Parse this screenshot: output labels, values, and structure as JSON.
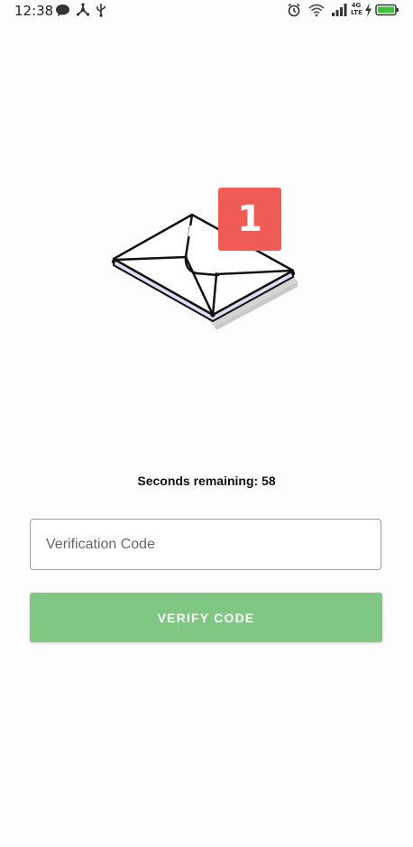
{
  "status_bar": {
    "time": "12:38",
    "left_icons": [
      "chat-bubble-icon",
      "network-share-icon",
      "usb-icon"
    ],
    "right_icons": [
      "alarm-icon",
      "wifi-icon",
      "signal-icon",
      "lte-icon",
      "charging-bolt-icon",
      "battery-icon"
    ],
    "network_label_top": "4G",
    "network_label_bottom": "LTE"
  },
  "illustration": {
    "badge_count": "1",
    "badge_color": "#f15b55"
  },
  "countdown": {
    "text": "Seconds remaining: 58"
  },
  "verification": {
    "placeholder": "Verification Code",
    "value": ""
  },
  "verify_button": {
    "label": "VERIFY CODE",
    "color": "#81c784"
  }
}
